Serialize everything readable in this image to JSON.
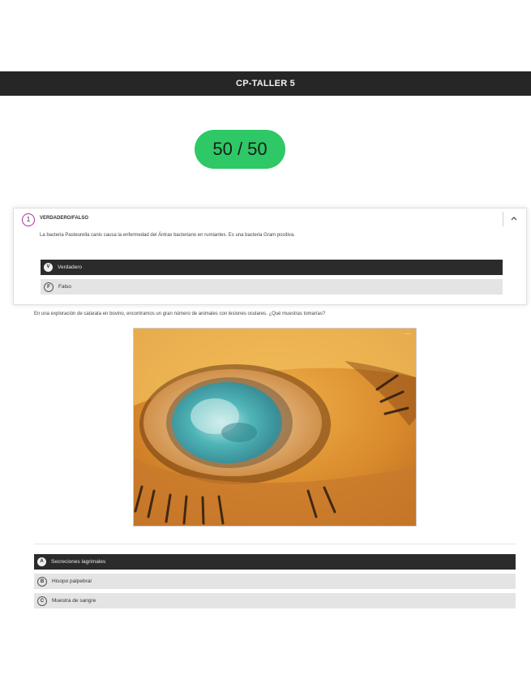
{
  "header": {
    "title": "CP-TALLER 5"
  },
  "score": {
    "text": "50 / 50",
    "color": "#2ec866"
  },
  "question1": {
    "number": "1",
    "type": "VERDADERO/FALSO",
    "text": "La bacteria Pasteurella canis causa la enfermedad del Ántrax bacteriano en rumiantes. Es una bacteria Gram positiva.",
    "collapse_icon": "chevron-up-icon",
    "options": [
      {
        "badge": "V",
        "label": "Verdadero",
        "selected": true
      },
      {
        "badge": "F",
        "label": "Falso",
        "selected": false
      }
    ]
  },
  "question2": {
    "text": "En una exploración de catarata en bovino, encontramos un gran número de animales con lesiones oculares. ¿Qué muestras tomarías?",
    "image": {
      "description_icon": "eye-photo",
      "more_icon": "more-icon"
    },
    "options": [
      {
        "badge": "A",
        "label": "Secreciones lagrimales",
        "selected": true
      },
      {
        "badge": "B",
        "label": "Hisopo palpebral",
        "selected": false
      },
      {
        "badge": "C",
        "label": "Muestra de sangre",
        "selected": false
      }
    ]
  }
}
